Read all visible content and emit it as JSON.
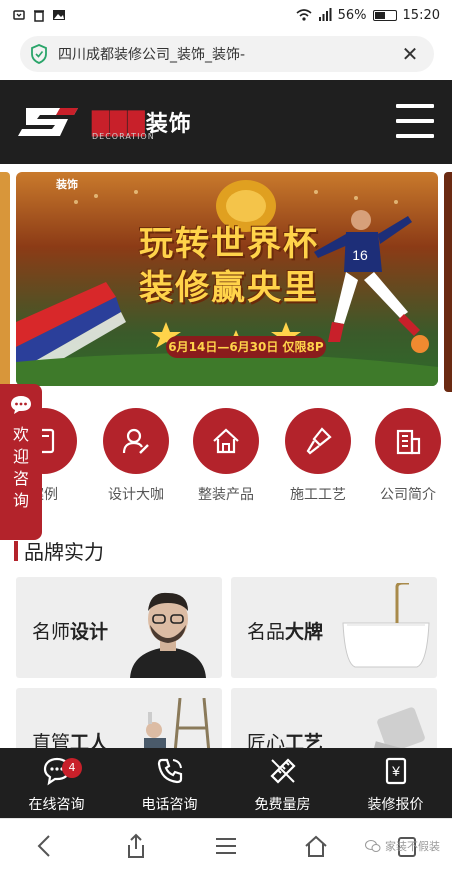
{
  "status": {
    "battery": "56%",
    "battery_level": 0.56,
    "time": "15:20"
  },
  "url": {
    "text": "四川成都装修公司_装饰_装饰-"
  },
  "header": {
    "brand_suffix": "装饰",
    "brand_sub": "DECORATION",
    "logo_letter": "S"
  },
  "banner": {
    "title_line1": "玩转世界杯",
    "title_line2": "装修赢央里",
    "date": "6月14日—6月30日 仅限8P",
    "brand": "装饰"
  },
  "nav": [
    {
      "label": "案例",
      "icon": "case-icon"
    },
    {
      "label": "设计大咖",
      "icon": "designer-icon"
    },
    {
      "label": "整装产品",
      "icon": "house-icon"
    },
    {
      "label": "施工工艺",
      "icon": "brush-icon"
    },
    {
      "label": "公司简介",
      "icon": "building-icon"
    }
  ],
  "float": {
    "text": "欢迎咨询"
  },
  "section": {
    "title": "品牌实力"
  },
  "cards": [
    {
      "prefix": "名师",
      "bold": "设计"
    },
    {
      "prefix": "名品",
      "bold": "大牌"
    },
    {
      "prefix": "直管",
      "bold": "工人"
    },
    {
      "prefix": "匠心",
      "bold": "工艺"
    }
  ],
  "bottom": [
    {
      "label": "在线咨询",
      "badge": "4",
      "icon": "chat-icon"
    },
    {
      "label": "电话咨询",
      "icon": "phone-icon"
    },
    {
      "label": "免费量房",
      "icon": "ruler-icon"
    },
    {
      "label": "装修报价",
      "icon": "quote-icon"
    }
  ],
  "watermark": {
    "text": "家装不假装"
  }
}
